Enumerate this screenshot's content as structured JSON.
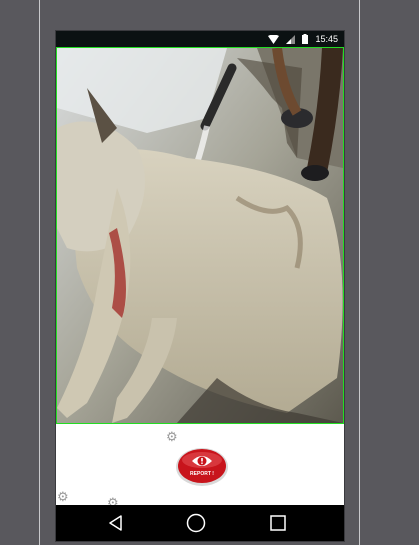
{
  "status_bar": {
    "time": "15:45",
    "icons": [
      "wifi-icon",
      "signal-icon",
      "battery-icon"
    ]
  },
  "photo": {
    "subject": "image"
  },
  "report_button": {
    "label": "REPORT !",
    "icon": "eye-alert-icon",
    "color": "#c8141c"
  },
  "decor": {
    "icons": [
      "gear-icon",
      "gear-icon",
      "gear-icon"
    ]
  },
  "nav_bar": {
    "icons": [
      "back-icon",
      "home-icon",
      "recents-icon"
    ]
  },
  "colors": {
    "background": "#59585d",
    "status_bar": "#0b1112",
    "photo_border": "#22dd22"
  }
}
